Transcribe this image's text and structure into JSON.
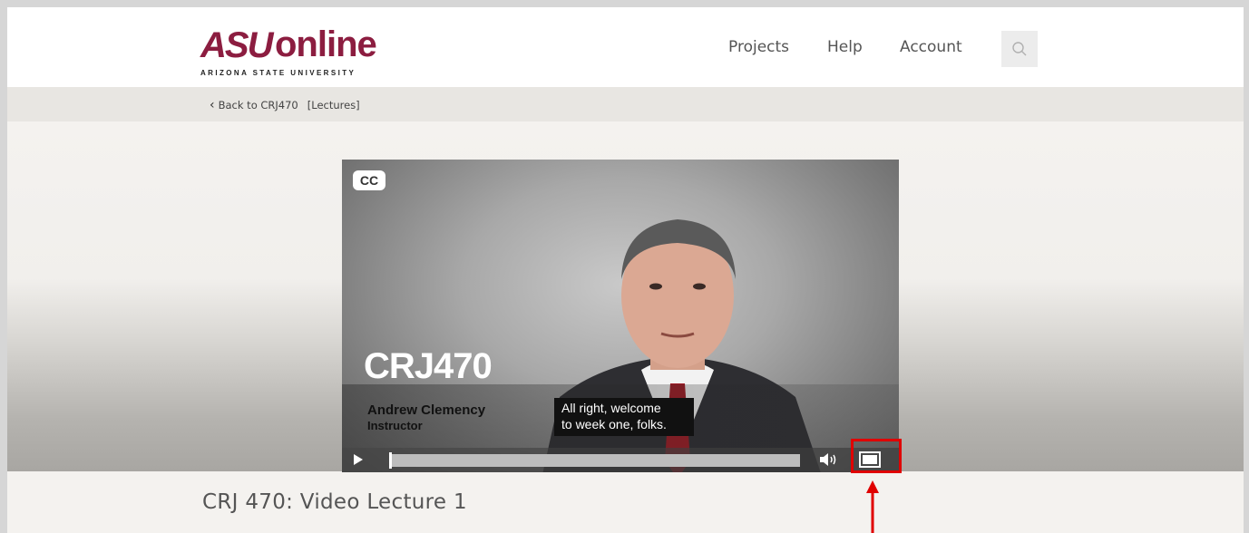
{
  "header": {
    "logo": {
      "brand": "ASU",
      "product": "online",
      "subtitle": "ARIZONA STATE UNIVERSITY"
    },
    "nav": [
      {
        "label": "Projects"
      },
      {
        "label": "Help"
      },
      {
        "label": "Account"
      }
    ],
    "search_icon": "search-icon"
  },
  "breadcrumb": {
    "back_label": "Back to CRJ470",
    "section_label": "[Lectures]"
  },
  "video": {
    "cc_label": "CC",
    "course_code": "CRJ470",
    "instructor_name": "Andrew Clemency",
    "instructor_role": "Instructor",
    "caption_line1": "All right, welcome",
    "caption_line2": "to week one, folks.",
    "progress": 0,
    "icons": [
      "play-icon",
      "volume-icon",
      "fullscreen-icon"
    ]
  },
  "page": {
    "title": "CRJ 470: Video Lecture 1"
  },
  "colors": {
    "brand": "#8c1d40",
    "highlight": "#e00000"
  }
}
